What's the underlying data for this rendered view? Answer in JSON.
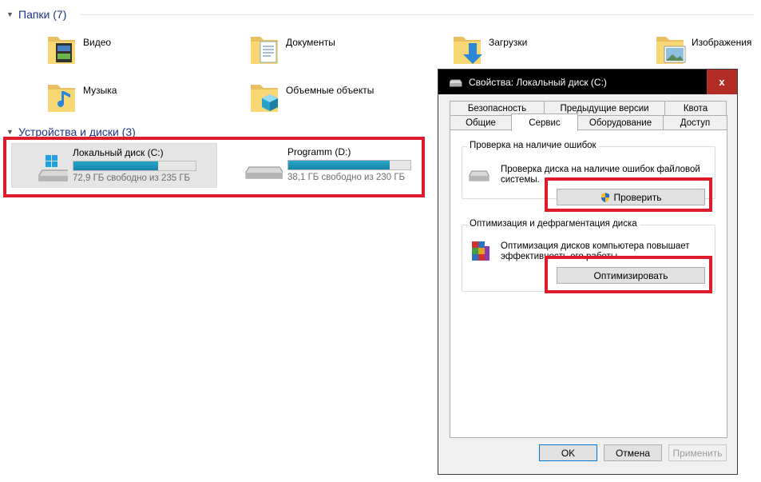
{
  "folders_group": {
    "title": "Папки (7)"
  },
  "folders": [
    {
      "label": "Видео",
      "icon": "video-folder-icon"
    },
    {
      "label": "Документы",
      "icon": "documents-folder-icon"
    },
    {
      "label": "Загрузки",
      "icon": "downloads-folder-icon"
    },
    {
      "label": "Изображения",
      "icon": "pictures-folder-icon"
    },
    {
      "label": "Музыка",
      "icon": "music-folder-icon"
    },
    {
      "label": "Объемные объекты",
      "icon": "3d-objects-folder-icon"
    }
  ],
  "drives_group": {
    "title": "Устройства и диски (3)"
  },
  "drives": [
    {
      "name": "Локальный диск (C:)",
      "free": "72,9 ГБ свободно из 235 ГБ",
      "used_fraction": 0.69
    },
    {
      "name": "Programm (D:)",
      "free": "38,1 ГБ свободно из 230 ГБ",
      "used_fraction": 0.83
    }
  ],
  "dialog": {
    "title": "Свойства: Локальный диск (C:)",
    "close_label": "x",
    "tabs_row1": [
      "Безопасность",
      "Предыдущие версии",
      "Квота"
    ],
    "tabs_row2": [
      "Общие",
      "Сервис",
      "Оборудование",
      "Доступ"
    ],
    "active_tab": "Сервис",
    "error_check": {
      "title": "Проверка на наличие ошибок",
      "description": "Проверка диска на наличие ошибок файловой системы.",
      "button": "Проверить"
    },
    "optimize": {
      "title": "Оптимизация и дефрагментация диска",
      "description": "Оптимизация дисков компьютера повышает эффективность его работы.",
      "button": "Оптимизировать"
    },
    "ok": "OK",
    "cancel": "Отмена",
    "apply": "Применить"
  },
  "colors": {
    "accent": "#1e3287",
    "highlight": "#dc1d2b",
    "bar_fill": "#1584a8"
  }
}
